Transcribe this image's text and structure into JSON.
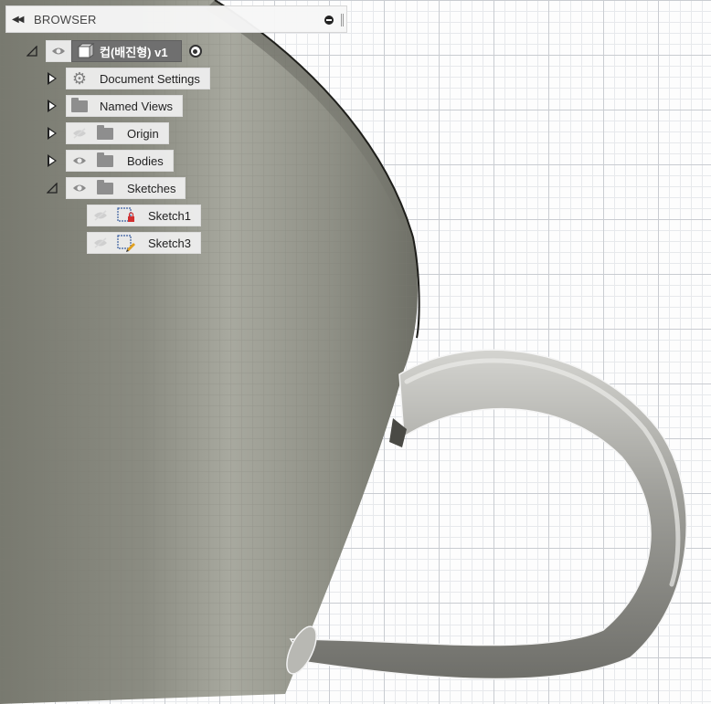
{
  "browser": {
    "title": "BROWSER",
    "root": {
      "label": "컵(배진형) v1"
    },
    "items": [
      {
        "label": "Document Settings",
        "icon": "gear-icon",
        "eye": null
      },
      {
        "label": "Named Views",
        "icon": "folder-icon",
        "eye": null
      },
      {
        "label": "Origin",
        "icon": "folder-icon",
        "eye": "hidden"
      },
      {
        "label": "Bodies",
        "icon": "folder-icon",
        "eye": "visible"
      },
      {
        "label": "Sketches",
        "icon": "folder-icon",
        "eye": "visible",
        "expanded": true
      }
    ],
    "sketches": [
      {
        "label": "Sketch1",
        "icon": "sketch-locked-icon",
        "eye": "hidden"
      },
      {
        "label": "Sketch3",
        "icon": "sketch-edit-icon",
        "eye": "hidden"
      }
    ]
  },
  "colors": {
    "grid_major": "#c9ccd1",
    "grid_minor": "#e7e9ec",
    "mug": "#8d8d85",
    "root_highlight": "#6f6f6f"
  }
}
